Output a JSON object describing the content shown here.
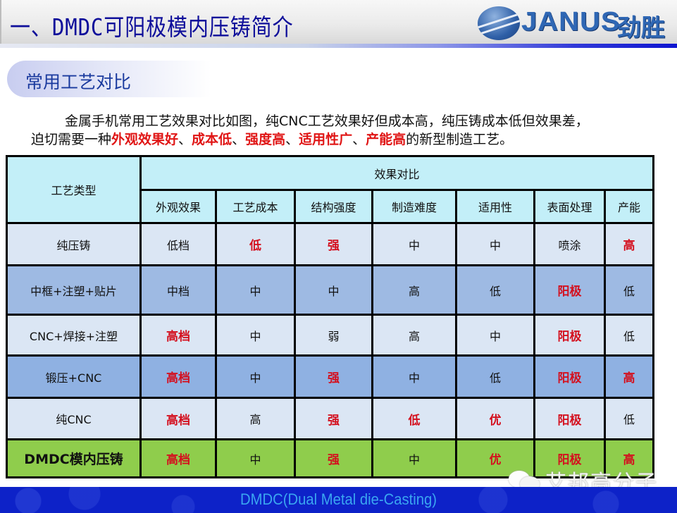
{
  "header": {
    "title": "一、DMDC可阳极模内压铸简介",
    "logo_text": "JANUS",
    "logo_cn": "劲胜",
    "logo_icon": "globe-logo-icon"
  },
  "section": {
    "subtitle": "常用工艺对比"
  },
  "intro": {
    "line1": "金属手机常用工艺效果对比如图，纯CNC工艺效果好但成本高，纯压铸成本低但效果差，",
    "line2_prefix": "迫切需要一种",
    "line2_highlights": [
      "外观效果好",
      "成本低",
      "强度高",
      "适用性广",
      "产能高"
    ],
    "separator": "、",
    "line2_suffix": "的新型制造工艺。"
  },
  "table": {
    "row_header": "工艺类型",
    "group_header": "效果对比",
    "columns": [
      "外观效果",
      "工艺成本",
      "结构强度",
      "制造难度",
      "适用性",
      "表面处理",
      "产能"
    ],
    "rows": [
      {
        "name": "纯压铸",
        "cells": [
          "低档",
          "低",
          "强",
          "中",
          "中",
          "喷涂",
          "高"
        ],
        "highlight": [
          false,
          true,
          true,
          false,
          false,
          false,
          true
        ]
      },
      {
        "name": "中框+注塑+贴片",
        "cells": [
          "中档",
          "中",
          "中",
          "高",
          "低",
          "阳极",
          "低"
        ],
        "highlight": [
          false,
          false,
          false,
          false,
          false,
          true,
          false
        ]
      },
      {
        "name": "CNC+焊接+注塑",
        "cells": [
          "高档",
          "中",
          "弱",
          "高",
          "中",
          "阳极",
          "低"
        ],
        "highlight": [
          true,
          false,
          false,
          false,
          false,
          true,
          false
        ]
      },
      {
        "name": "锻压+CNC",
        "cells": [
          "高档",
          "中",
          "强",
          "中",
          "低",
          "阳极",
          "高"
        ],
        "highlight": [
          true,
          false,
          true,
          false,
          false,
          true,
          true
        ]
      },
      {
        "name": "纯CNC",
        "cells": [
          "高档",
          "高",
          "强",
          "低",
          "优",
          "阳极",
          "低"
        ],
        "highlight": [
          true,
          false,
          true,
          true,
          true,
          true,
          false
        ]
      },
      {
        "name": "DMDC模内压铸",
        "cells": [
          "高档",
          "中",
          "强",
          "中",
          "优",
          "阳极",
          "高"
        ],
        "highlight": [
          true,
          false,
          true,
          false,
          true,
          true,
          true
        ]
      }
    ]
  },
  "watermark": {
    "icon": "wechat-icon",
    "text": "艾邦高分子"
  },
  "footer": {
    "text": "DMDC(Dual Metal die-Casting)"
  },
  "colors": {
    "title": "#0e0e9a",
    "highlight_red": "#d4101e",
    "header_cell": "#c3eff8",
    "row_light": "#dbe6f4",
    "row_dark": "#9ebae3",
    "row_green": "#8fcd4c",
    "footer_bg": "#0d22c8",
    "footer_text": "#3aa6f0"
  }
}
